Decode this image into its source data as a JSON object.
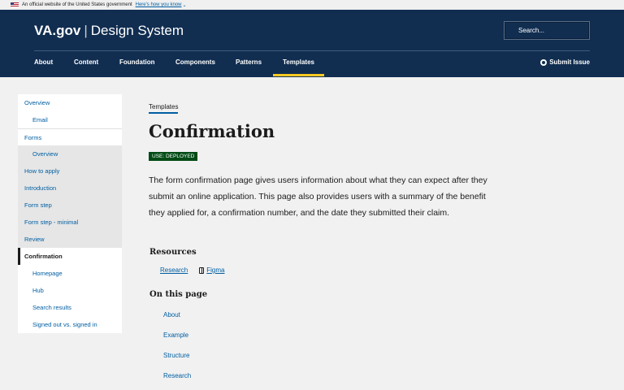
{
  "banner": {
    "text": "An official website of the United States government",
    "link": "Here's how you know"
  },
  "header": {
    "logo_main": "VA.gov",
    "logo_sep": "|",
    "logo_sub": "Design System",
    "search_placeholder": "Search...",
    "nav": [
      "About",
      "Content",
      "Foundation",
      "Components",
      "Patterns",
      "Templates"
    ],
    "active_nav": "Templates",
    "submit": "Submit Issue"
  },
  "sidenav": {
    "items": [
      {
        "label": "Overview"
      },
      {
        "label": "Email"
      },
      {
        "label": "Forms"
      },
      {
        "label": "Overview"
      },
      {
        "label": "How to apply"
      },
      {
        "label": "Introduction"
      },
      {
        "label": "Form step"
      },
      {
        "label": "Form step - minimal"
      },
      {
        "label": "Review"
      },
      {
        "label": "Confirmation"
      },
      {
        "label": "Homepage"
      },
      {
        "label": "Hub"
      },
      {
        "label": "Search results"
      },
      {
        "label": "Signed out vs. signed in"
      }
    ],
    "current": "Confirmation"
  },
  "main": {
    "breadcrumb": "Templates",
    "title": "Confirmation",
    "status": "USE: DEPLOYED",
    "description": "The form confirmation page gives users information about what they can expect after they submit an online application. This page also provides users with a summary of the benefit they applied for, a confirmation number, and the date they submitted their claim.",
    "resources_title": "Resources",
    "resources": [
      "Research",
      "Figma"
    ],
    "on_this_page_title": "On this page",
    "on_this_page": [
      "About",
      "Example",
      "Structure",
      "Research"
    ]
  },
  "colors": {
    "header_bg": "#112e51",
    "active_underline": "#fac922",
    "link": "#005ea2",
    "status_bg": "#004b15"
  }
}
